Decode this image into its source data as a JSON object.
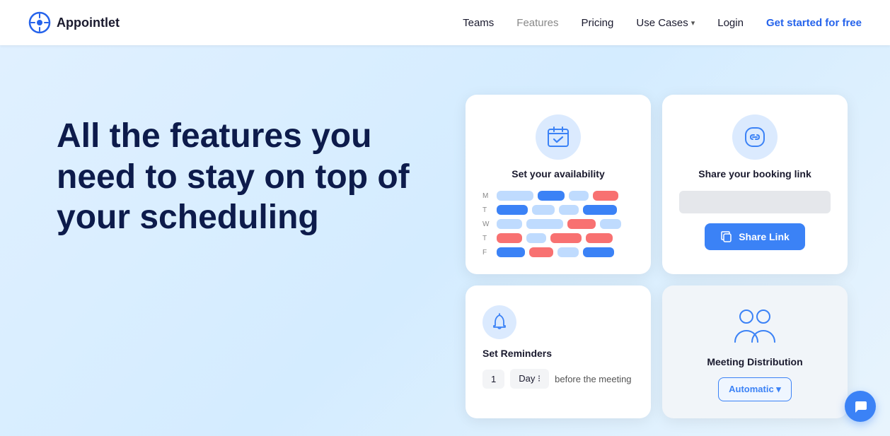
{
  "navbar": {
    "logo_text": "Appointlet",
    "links": [
      {
        "label": "Teams",
        "id": "teams",
        "style": "dark"
      },
      {
        "label": "Features",
        "id": "features",
        "style": "active"
      },
      {
        "label": "Pricing",
        "id": "pricing",
        "style": "dark"
      },
      {
        "label": "Use Cases",
        "id": "use-cases",
        "style": "dark"
      },
      {
        "label": "Login",
        "id": "login",
        "style": "dark"
      },
      {
        "label": "Get started for free",
        "id": "cta",
        "style": "blue"
      }
    ]
  },
  "hero": {
    "title": "All the features you need to stay on top of your scheduling"
  },
  "cards": {
    "availability": {
      "title": "Set your availability",
      "days": [
        "M",
        "T",
        "W",
        "T",
        "F"
      ]
    },
    "share_link": {
      "title": "Share your booking link",
      "button_label": "Share Link"
    },
    "reminders": {
      "title": "Set Reminders",
      "number": "1",
      "unit": "Day",
      "suffix": "before the meeting"
    },
    "meeting_distribution": {
      "title": "Meeting Distribution",
      "dropdown_label": "Automatic ▾"
    }
  }
}
